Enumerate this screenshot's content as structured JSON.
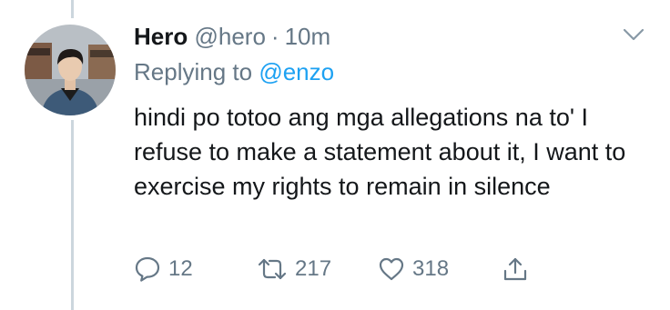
{
  "tweet": {
    "display_name": "Hero",
    "handle": "@hero",
    "separator": "·",
    "time": "10m",
    "replying_prefix": "Replying to",
    "replying_to": "@enzo",
    "text": "hindi po totoo ang mga allegations na to' I refuse to make a statement about it, I want to exercise my rights to remain in silence"
  },
  "actions": {
    "reply_count": "12",
    "retweet_count": "217",
    "like_count": "318"
  },
  "icons": {
    "reply": "reply-icon",
    "retweet": "retweet-icon",
    "like": "heart-icon",
    "share": "share-icon",
    "menu": "chevron-down-icon"
  },
  "colors": {
    "text": "#14171a",
    "muted": "#657786",
    "link": "#1da1f2",
    "thread_line": "#ccd6dd"
  }
}
